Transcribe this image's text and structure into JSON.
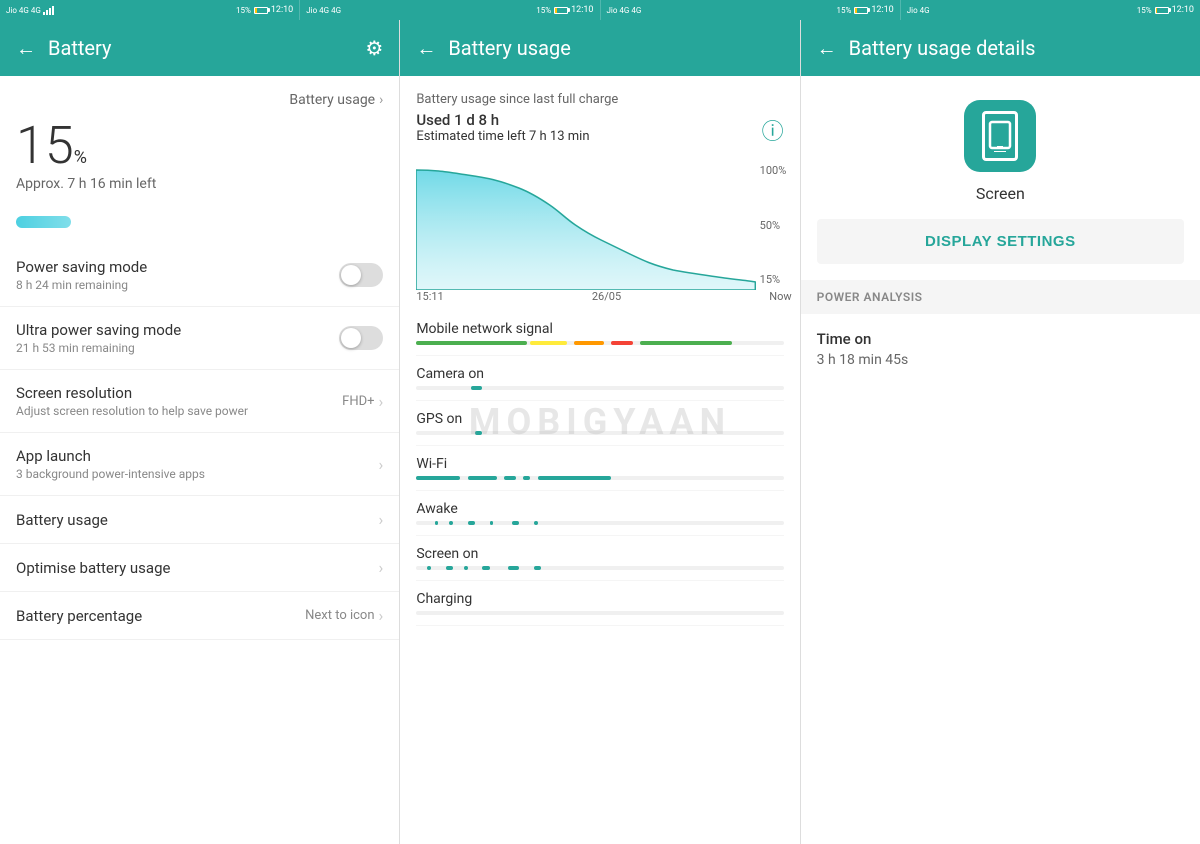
{
  "statusBar": {
    "sections": [
      {
        "carrier": "Jio 4G",
        "signal": "4G",
        "battery": "15%",
        "time": "12:10"
      },
      {
        "carrier": "Jio 4G",
        "signal": "4G",
        "battery": "15%",
        "time": "12:10"
      },
      {
        "carrier": "Jio 4G",
        "signal": "4G",
        "battery": "15%",
        "time": "12:10"
      },
      {
        "carrier": "Jio 4G",
        "signal": "4G",
        "battery": "15%",
        "time": "12:10"
      }
    ]
  },
  "panel1": {
    "header": {
      "back_label": "←",
      "title": "Battery",
      "settings_icon": "⚙"
    },
    "battery_usage_link": "Battery usage",
    "battery_percent_number": "15",
    "battery_percent_symbol": "%",
    "battery_approx": "Approx. 7 h 16 min left",
    "items": [
      {
        "title": "Power saving mode",
        "subtitle": "8 h 24 min remaining",
        "type": "toggle",
        "value": "off"
      },
      {
        "title": "Ultra power saving mode",
        "subtitle": "21 h 53 min remaining",
        "type": "toggle",
        "value": "off"
      },
      {
        "title": "Screen resolution",
        "subtitle": "Adjust screen resolution to help save power",
        "type": "value",
        "value": "FHD+"
      },
      {
        "title": "App launch",
        "subtitle": "3 background power-intensive apps",
        "type": "chevron",
        "value": ""
      },
      {
        "title": "Battery usage",
        "subtitle": "",
        "type": "chevron",
        "value": ""
      },
      {
        "title": "Optimise battery usage",
        "subtitle": "",
        "type": "chevron",
        "value": ""
      },
      {
        "title": "Battery percentage",
        "subtitle": "",
        "type": "value",
        "value": "Next to icon"
      }
    ]
  },
  "panel2": {
    "header": {
      "back_label": "←",
      "title": "Battery usage"
    },
    "usage_since": "Battery usage since last full charge",
    "usage_used": "Used 1 d 8 h",
    "usage_estimated": "Estimated time left 7 h 13 min",
    "chart": {
      "y_labels": [
        "100%",
        "50%",
        "15%"
      ],
      "x_labels": [
        "15:11",
        "26/05",
        "Now"
      ]
    },
    "rows": [
      {
        "title": "Mobile network signal",
        "bars": [
          {
            "color": "#4caf50",
            "left": "0%",
            "width": "30%"
          },
          {
            "color": "#ffeb3b",
            "left": "31%",
            "width": "15%"
          },
          {
            "color": "#ff9800",
            "left": "47%",
            "width": "10%"
          },
          {
            "color": "#f44336",
            "left": "58%",
            "width": "8%"
          },
          {
            "color": "#4caf50",
            "left": "67%",
            "width": "20%"
          }
        ]
      },
      {
        "title": "Camera on",
        "bars": [
          {
            "color": "#26a69a",
            "left": "15%",
            "width": "3%"
          }
        ]
      },
      {
        "title": "GPS on",
        "bars": [
          {
            "color": "#26a69a",
            "left": "18%",
            "width": "2%"
          }
        ]
      },
      {
        "title": "Wi-Fi",
        "bars": [
          {
            "color": "#26a69a",
            "left": "0%",
            "width": "12%"
          },
          {
            "color": "#26a69a",
            "left": "14%",
            "width": "8%"
          },
          {
            "color": "#26a69a",
            "left": "24%",
            "width": "4%"
          },
          {
            "color": "#26a69a",
            "left": "30%",
            "width": "2%"
          },
          {
            "color": "#26a69a",
            "left": "34%",
            "width": "18%"
          }
        ]
      },
      {
        "title": "Awake",
        "bars": [
          {
            "color": "#26a69a",
            "left": "5%",
            "width": "2%"
          },
          {
            "color": "#26a69a",
            "left": "9%",
            "width": "1%"
          },
          {
            "color": "#26a69a",
            "left": "12%",
            "width": "2%"
          },
          {
            "color": "#26a69a",
            "left": "16%",
            "width": "1%"
          },
          {
            "color": "#26a69a",
            "left": "22%",
            "width": "3%"
          },
          {
            "color": "#26a69a",
            "left": "28%",
            "width": "1%"
          },
          {
            "color": "#26a69a",
            "left": "35%",
            "width": "2%"
          }
        ]
      },
      {
        "title": "Screen on",
        "bars": [
          {
            "color": "#26a69a",
            "left": "3%",
            "width": "1%"
          },
          {
            "color": "#26a69a",
            "left": "6%",
            "width": "2%"
          },
          {
            "color": "#26a69a",
            "left": "11%",
            "width": "1%"
          },
          {
            "color": "#26a69a",
            "left": "15%",
            "width": "2%"
          },
          {
            "color": "#26a69a",
            "left": "20%",
            "width": "1%"
          },
          {
            "color": "#26a69a",
            "left": "25%",
            "width": "3%"
          },
          {
            "color": "#26a69a",
            "left": "32%",
            "width": "2%"
          }
        ]
      },
      {
        "title": "Charging",
        "bars": []
      }
    ]
  },
  "panel3": {
    "header": {
      "back_label": "←",
      "title": "Battery usage details"
    },
    "screen_label": "Screen",
    "display_settings_btn": "DISPLAY SETTINGS",
    "power_analysis_title": "POWER ANALYSIS",
    "time_on_label": "Time on",
    "time_on_value": "3 h 18 min 45s"
  },
  "watermark": "MOBIGYAAN"
}
